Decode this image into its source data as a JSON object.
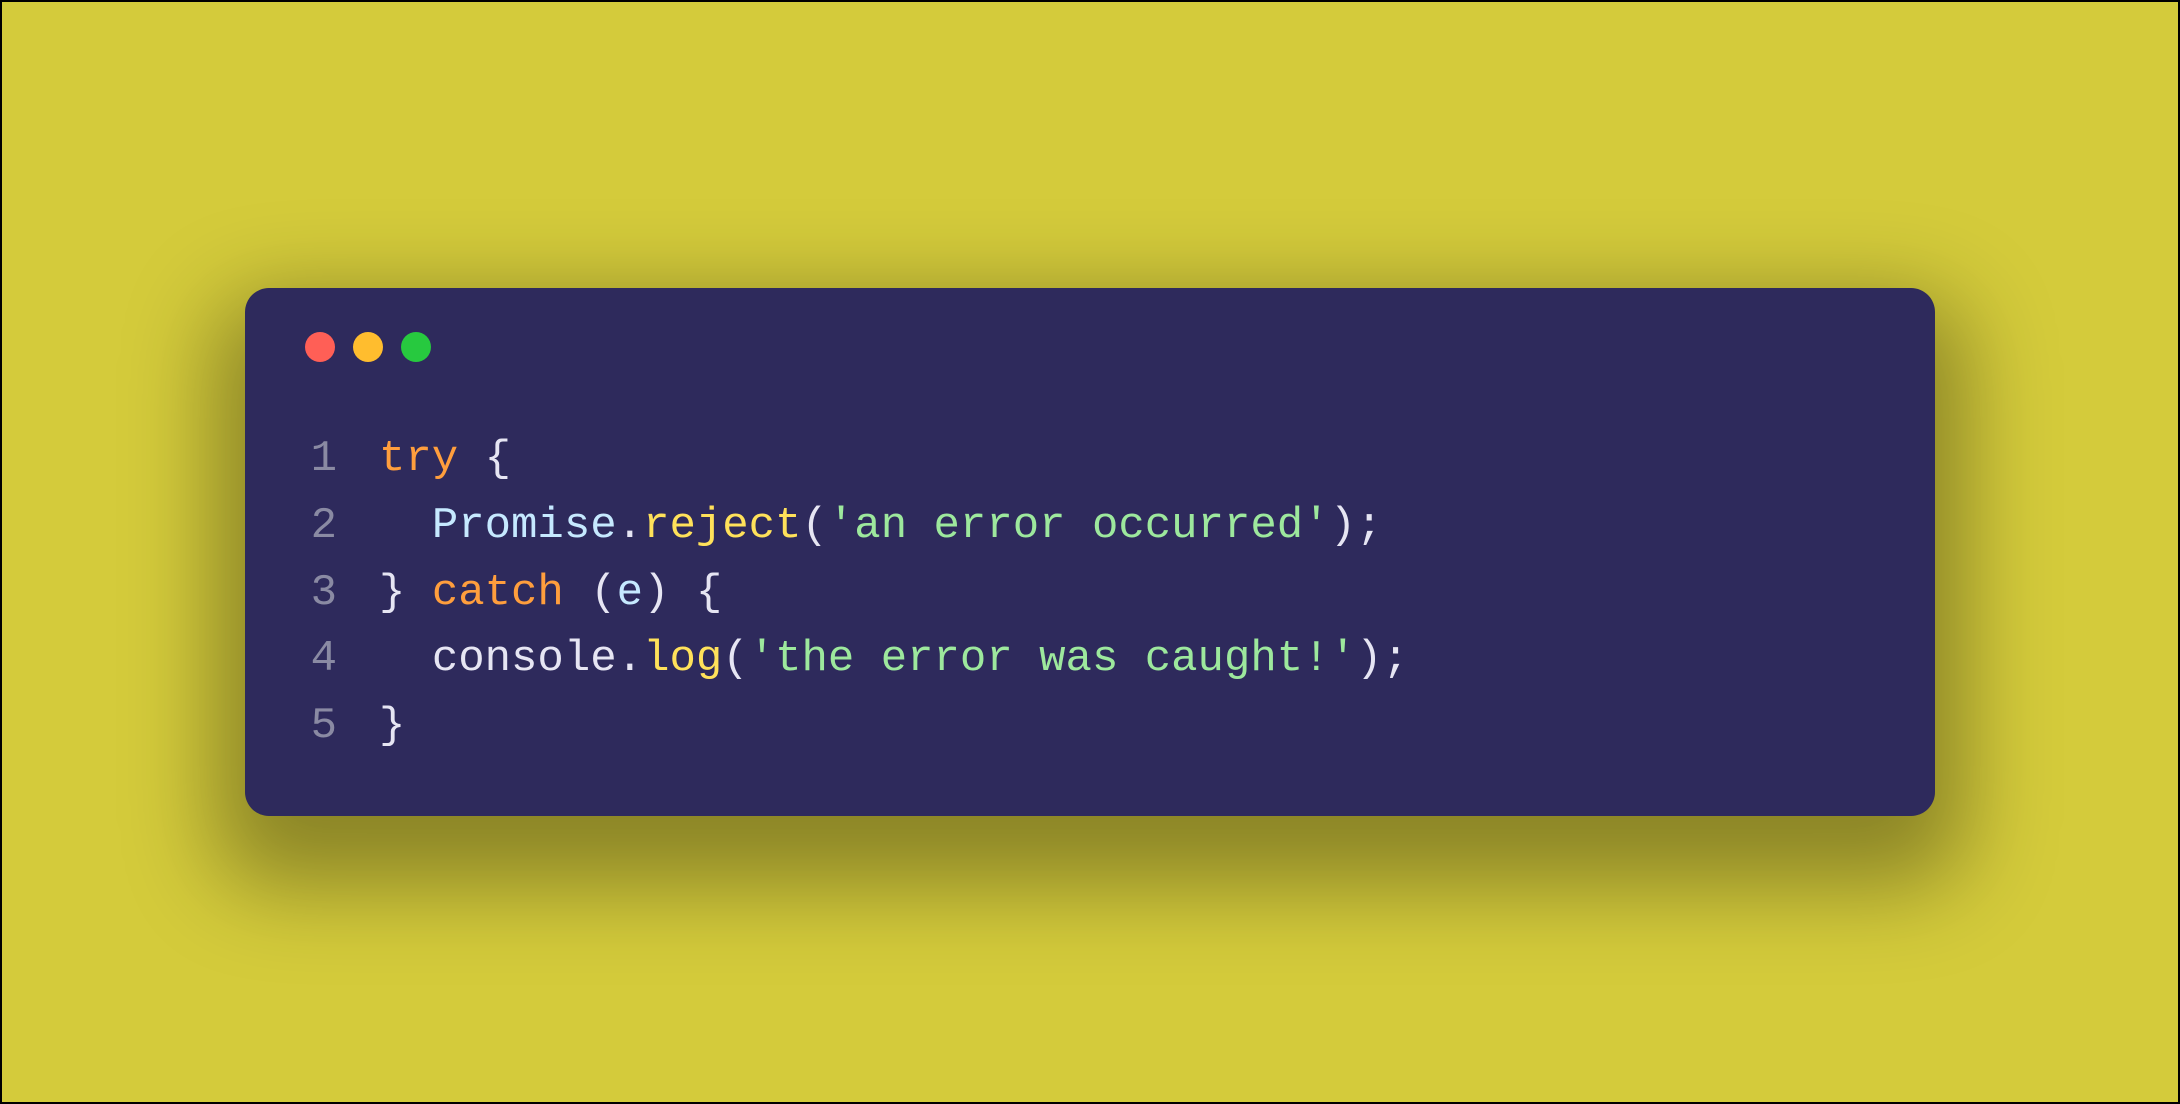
{
  "window": {
    "dots": [
      "red",
      "yellow",
      "green"
    ]
  },
  "code": {
    "lines": [
      {
        "n": "1",
        "tokens": [
          {
            "cls": "kw",
            "t": "try"
          },
          {
            "cls": "punc",
            "t": " {"
          }
        ]
      },
      {
        "n": "2",
        "tokens": [
          {
            "cls": "punc",
            "t": "  "
          },
          {
            "cls": "cls",
            "t": "Promise"
          },
          {
            "cls": "punc",
            "t": "."
          },
          {
            "cls": "fn",
            "t": "reject"
          },
          {
            "cls": "punc",
            "t": "("
          },
          {
            "cls": "str",
            "t": "'an error occurred'"
          },
          {
            "cls": "punc",
            "t": ");"
          }
        ]
      },
      {
        "n": "3",
        "tokens": [
          {
            "cls": "punc",
            "t": "} "
          },
          {
            "cls": "kw",
            "t": "catch"
          },
          {
            "cls": "punc",
            "t": " ("
          },
          {
            "cls": "var",
            "t": "e"
          },
          {
            "cls": "punc",
            "t": ") {"
          }
        ]
      },
      {
        "n": "4",
        "tokens": [
          {
            "cls": "punc",
            "t": "  "
          },
          {
            "cls": "obj",
            "t": "console"
          },
          {
            "cls": "punc",
            "t": "."
          },
          {
            "cls": "fn",
            "t": "log"
          },
          {
            "cls": "punc",
            "t": "("
          },
          {
            "cls": "str",
            "t": "'the error was caught!'"
          },
          {
            "cls": "punc",
            "t": ");"
          }
        ]
      },
      {
        "n": "5",
        "tokens": [
          {
            "cls": "punc",
            "t": "}"
          }
        ]
      }
    ]
  }
}
